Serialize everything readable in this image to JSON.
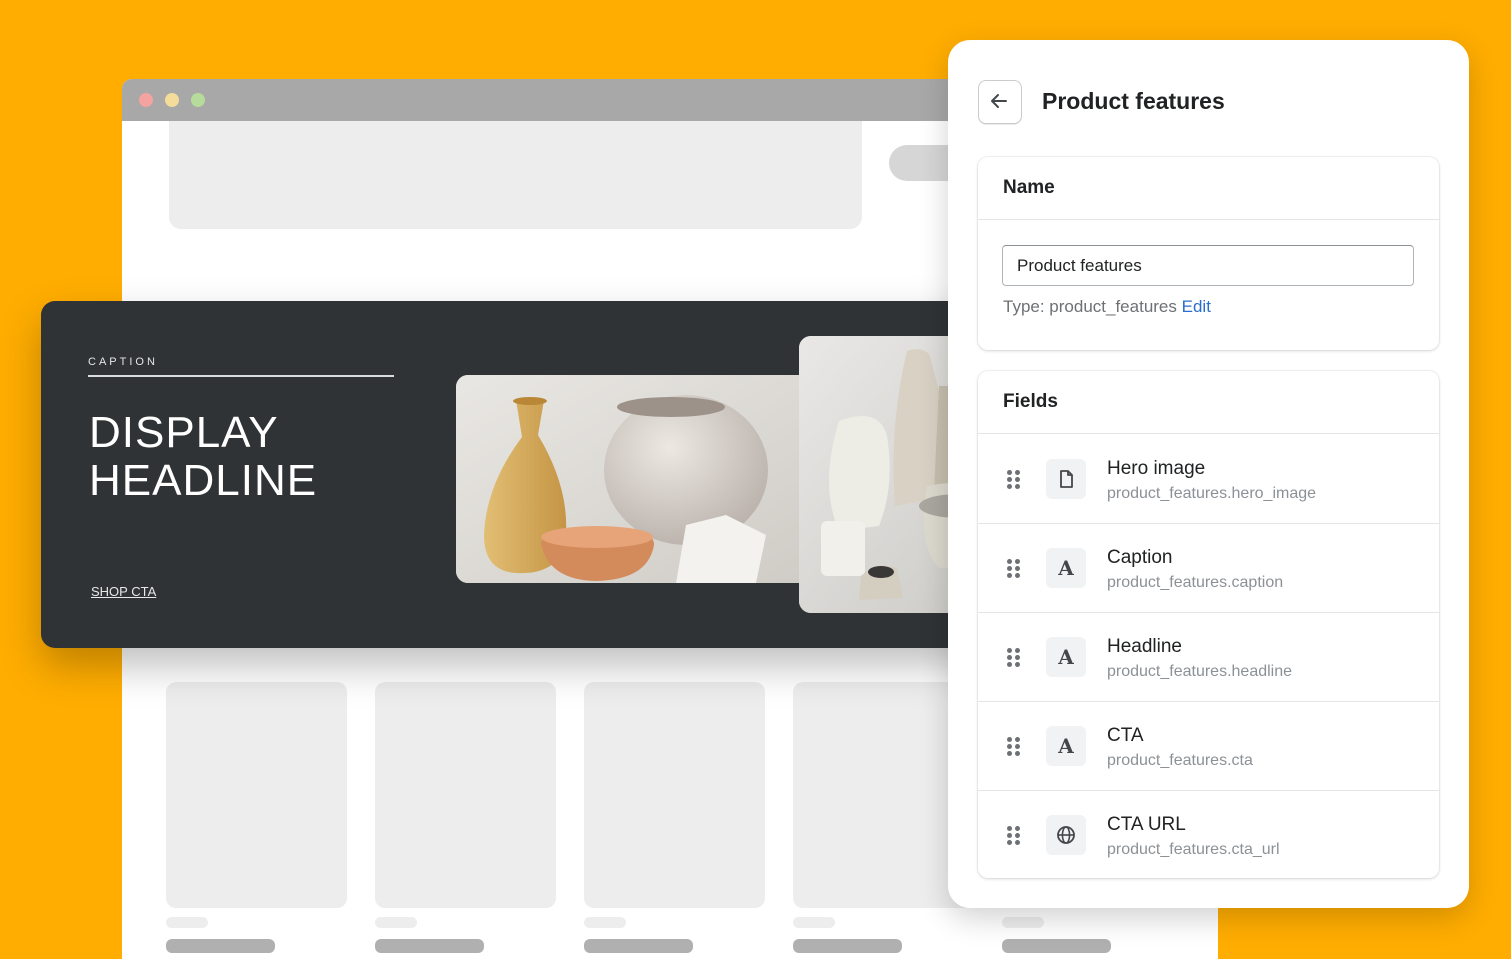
{
  "hero": {
    "caption": "CAPTION",
    "headline_line1": "DISPLAY",
    "headline_line2": "HEADLINE",
    "cta": "SHOP CTA"
  },
  "panel": {
    "title": "Product features",
    "back_icon": "arrow-left-icon",
    "name_section": {
      "heading": "Name",
      "input_value": "Product features",
      "type_label": "Type: product_features",
      "edit_link": "Edit"
    },
    "fields_section": {
      "heading": "Fields",
      "items": [
        {
          "name": "Hero image",
          "key": "product_features.hero_image",
          "icon": "file-icon"
        },
        {
          "name": "Caption",
          "key": "product_features.caption",
          "icon": "text-icon"
        },
        {
          "name": "Headline",
          "key": "product_features.headline",
          "icon": "text-icon"
        },
        {
          "name": "CTA",
          "key": "product_features.cta",
          "icon": "text-icon"
        },
        {
          "name": "CTA URL",
          "key": "product_features.cta_url",
          "icon": "globe-icon"
        }
      ]
    }
  },
  "colors": {
    "background": "#FFAD00",
    "hero_bg": "#2F3335",
    "link": "#2C6ECB"
  }
}
